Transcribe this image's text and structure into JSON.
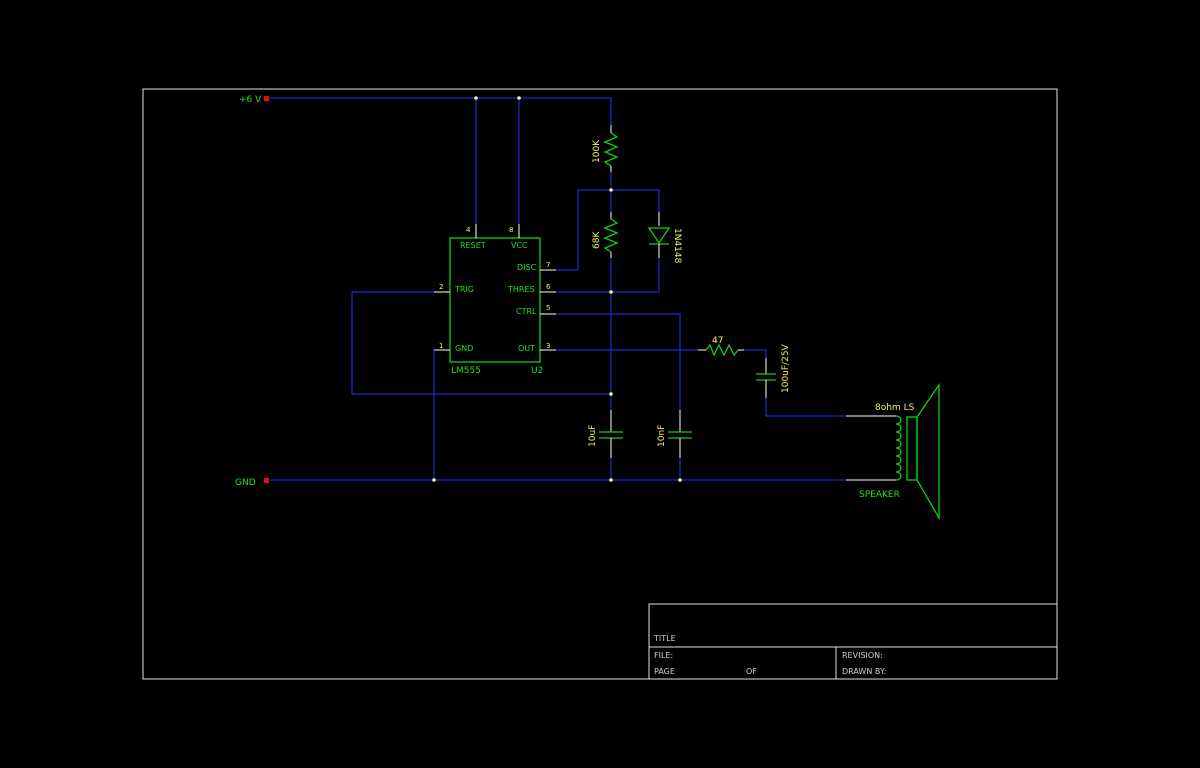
{
  "power": {
    "vcc_label": "+6 V",
    "gnd_label": "GND"
  },
  "ic": {
    "name": "LM555",
    "ref": "U2",
    "pins": {
      "reset": {
        "label": "RESET",
        "num": "4"
      },
      "vcc": {
        "label": "VCC",
        "num": "8"
      },
      "disc": {
        "label": "DISC",
        "num": "7"
      },
      "thres": {
        "label": "THRES",
        "num": "6"
      },
      "trig": {
        "label": "TRIG",
        "num": "2"
      },
      "ctrl": {
        "label": "CTRL",
        "num": "5"
      },
      "gnd": {
        "label": "GND",
        "num": "1"
      },
      "out": {
        "label": "OUT",
        "num": "3"
      }
    }
  },
  "components": {
    "r1": "100K",
    "r2": "68K",
    "diode": "1N4148",
    "r3": "47",
    "c_out": "100uF/25V",
    "c1": "10uF",
    "c2": "10nF",
    "speaker_value": "8ohm LS",
    "speaker_ref": "SPEAKER"
  },
  "title_block": {
    "title": "TITLE",
    "file": "FILE:",
    "page": "PAGE",
    "of": "OF",
    "revision": "REVISION:",
    "drawn_by": "DRAWN BY:"
  },
  "colors": {
    "wire": "#1a2bd6",
    "component": "#10d010",
    "value_text": "#f0f060",
    "junction": "#f0f0a0",
    "power_flag": "#e01010"
  }
}
